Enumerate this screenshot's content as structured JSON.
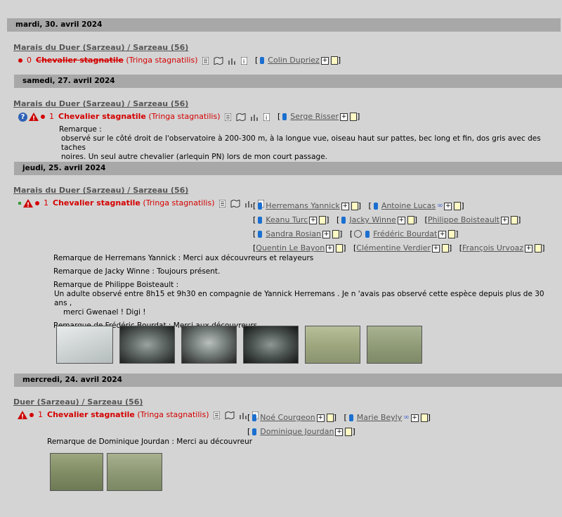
{
  "common": {
    "species": "Chevalier stagnatile",
    "sci": "(Tringa stagnatilis)",
    "remark_label": "Remarque :"
  },
  "days": [
    {
      "date": "mardi, 30. avril 2024",
      "location": "Marais du Duer (Sarzeau) / Sarzeau (56)",
      "count": "0",
      "observers": [
        "Colin Dupriez"
      ]
    },
    {
      "date": "samedi, 27. avril 2024",
      "location": "Marais du Duer (Sarzeau) / Sarzeau (56)",
      "count": "1",
      "observers": [
        "Serge Risser"
      ],
      "remark_lines": [
        "observé sur le côté droit de l'observatoire à 200-300 m, à la longue vue, oiseau haut sur pattes, bec long et fin, dos gris avec des taches",
        "noires. Un seul autre chevalier (arlequin PN) lors de mon court passage."
      ]
    },
    {
      "date": "jeudi, 25. avril 2024",
      "location": "Marais du Duer (Sarzeau) / Sarzeau (56)",
      "count": "1",
      "observers": [
        "Herremans Yannick",
        "Antoine Lucas",
        "Keanu Turc",
        "Jacky Winne",
        "Philippe Boisteault",
        "Sandra Rosian",
        "Frédéric Bourdat",
        "Quentin Le Bayon",
        "Clémentine Verdier",
        "François Urvoaz"
      ],
      "remarks": [
        "Remarque de Herremans Yannick : Merci aux découvreurs et relayeurs",
        "Remarque de Jacky Winne : Toujours présent.",
        "Remarque de Philippe Boisteault :",
        "Un adulte observé entre 8h15 et 9h30 en compagnie de Yannick Herremans . Je n 'avais pas observé cette espèce depuis plus de 30 ans ,",
        "merci Gwenael ! Digi !",
        "Remarque de Frédéric Bourdat : Merci aux découvreurs"
      ]
    },
    {
      "date": "mercredi, 24. avril 2024",
      "location": "Duer (Sarzeau) / Sarzeau (56)",
      "count": "1",
      "observers": [
        "Noé Courgeon",
        "Marie Beyly",
        "Dominique Jourdan"
      ],
      "remarks": [
        "Remarque de Dominique Jourdan : Merci au découvreur"
      ]
    }
  ],
  "colors": {
    "accent": "#d40000",
    "header_bg": "#a8a8a8",
    "page_bg": "#d4d4d4"
  }
}
